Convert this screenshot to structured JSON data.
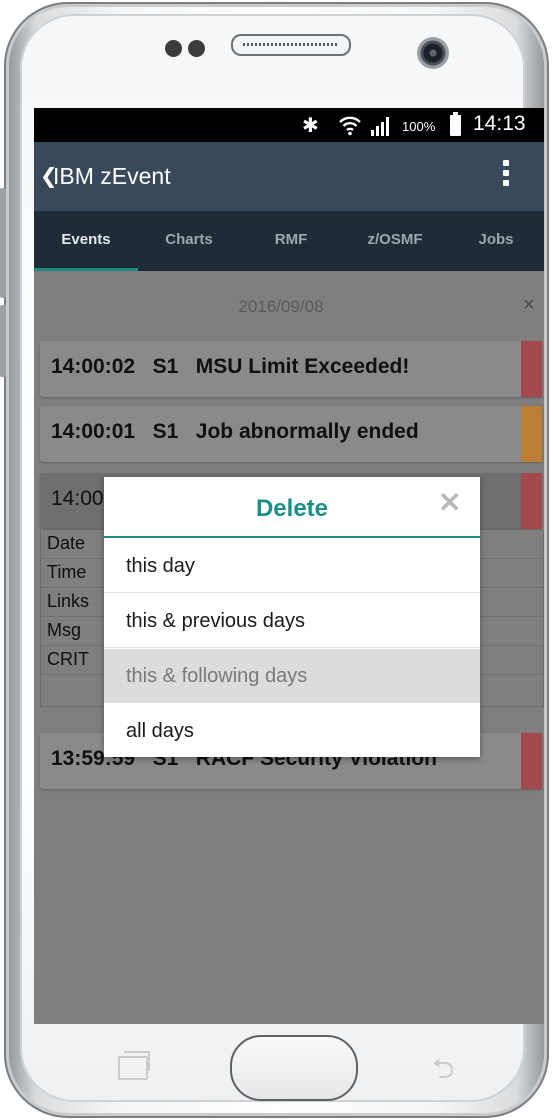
{
  "status_bar": {
    "bluetooth_icon": "bluetooth-icon",
    "wifi_icon": "wifi-icon",
    "signal_icon": "signal-icon",
    "battery_percent": "100%",
    "time": "14:13"
  },
  "app_bar": {
    "back_glyph": "❮",
    "title": "IBM zEvent",
    "menu_icon": "overflow-menu-icon"
  },
  "tabs": [
    {
      "label": "Events",
      "active": true
    },
    {
      "label": "Charts",
      "active": false
    },
    {
      "label": "RMF",
      "active": false
    },
    {
      "label": "z/OSMF",
      "active": false
    },
    {
      "label": "Jobs",
      "active": false
    }
  ],
  "date_header": {
    "date": "2016/09/08",
    "close_glyph": "×"
  },
  "events": [
    {
      "time": "14:00:02",
      "system": "S1",
      "message": "MSU Limit Exceeded!",
      "severity_color": "#a3494c"
    },
    {
      "time": "14:00:01",
      "system": "S1",
      "message": "Job abnormally ended",
      "severity_color": "#bb8033"
    },
    {
      "time": "14:00",
      "system": "",
      "message": "",
      "severity_color": "#a3494c"
    },
    {
      "time": "13:59:59",
      "system": "S1",
      "message": "RACF Security Violation",
      "severity_color": "#a3494c"
    }
  ],
  "event_detail_labels": [
    "Date",
    "Time",
    "Links",
    "Msg",
    "CRIT"
  ],
  "dialog": {
    "title": "Delete",
    "close_glyph": "✕",
    "options": [
      "this day",
      "this & previous days",
      "this & following days",
      "all days"
    ],
    "highlighted_index": 2
  },
  "colors": {
    "app_bar": "#37495b",
    "tab_bar": "#1f2c38",
    "accent": "#1b8f88",
    "critical": "#a3494c",
    "warning": "#bb8033"
  }
}
